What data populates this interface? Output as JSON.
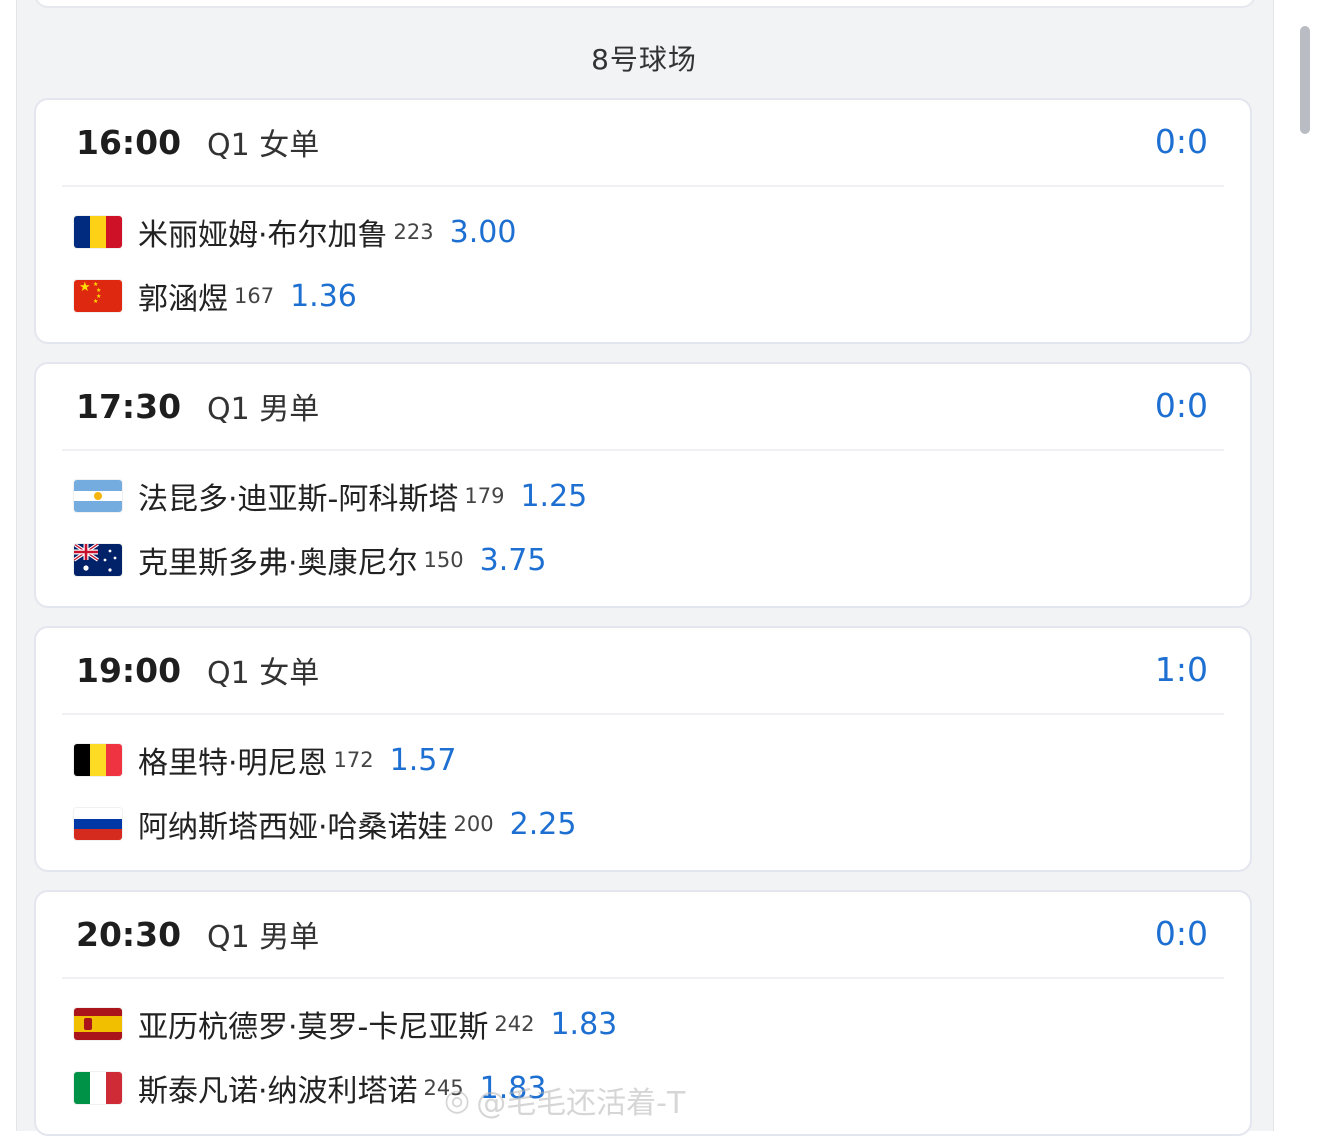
{
  "court_title": "8号球场",
  "matches": [
    {
      "time": "16:00",
      "round": "Q1 女单",
      "score": "0:0",
      "players": [
        {
          "flag": "romania-flag",
          "name": "米丽娅姆·布尔加鲁",
          "rank": "223",
          "odds": "3.00"
        },
        {
          "flag": "china-flag",
          "name": "郭涵煜",
          "rank": "167",
          "odds": "1.36"
        }
      ]
    },
    {
      "time": "17:30",
      "round": "Q1 男单",
      "score": "0:0",
      "players": [
        {
          "flag": "argentina-flag",
          "name": "法昆多·迪亚斯-阿科斯塔",
          "rank": "179",
          "odds": "1.25"
        },
        {
          "flag": "australia-flag",
          "name": "克里斯多弗·奥康尼尔",
          "rank": "150",
          "odds": "3.75"
        }
      ]
    },
    {
      "time": "19:00",
      "round": "Q1 女单",
      "score": "1:0",
      "players": [
        {
          "flag": "belgium-flag",
          "name": "格里特·明尼恩",
          "rank": "172",
          "odds": "1.57"
        },
        {
          "flag": "russia-flag",
          "name": "阿纳斯塔西娅·哈桑诺娃",
          "rank": "200",
          "odds": "2.25"
        }
      ]
    },
    {
      "time": "20:30",
      "round": "Q1 男单",
      "score": "0:0",
      "players": [
        {
          "flag": "spain-flag",
          "name": "亚历杭德罗·莫罗-卡尼亚斯",
          "rank": "242",
          "odds": "1.83"
        },
        {
          "flag": "italy-flag",
          "name": "斯泰凡诺·纳波利塔诺",
          "rank": "245",
          "odds": "1.83"
        }
      ]
    }
  ],
  "watermark": "@毛毛还活着-T",
  "colors": {
    "accent": "#1d6fd1",
    "panel": "#f2f3f5",
    "card_border": "#e3e6ee"
  }
}
